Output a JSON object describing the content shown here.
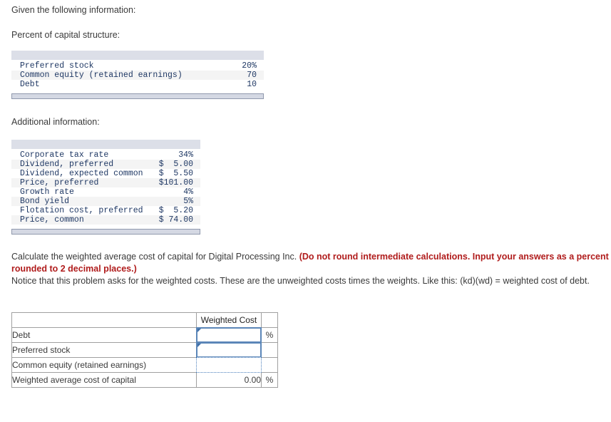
{
  "intro": {
    "given_label": "Given the following information:",
    "percent_label": "Percent of capital structure:",
    "additional_label": "Additional information:"
  },
  "capital_structure": {
    "rows": [
      {
        "label": "Preferred stock",
        "value": "20%"
      },
      {
        "label": "Common equity (retained earnings)",
        "value": "70"
      },
      {
        "label": "Debt",
        "value": "10"
      }
    ]
  },
  "additional_information": {
    "rows": [
      {
        "label": "Corporate tax rate",
        "value": "34%"
      },
      {
        "label": "Dividend, preferred",
        "value": "$  5.00"
      },
      {
        "label": "Dividend, expected common",
        "value": "$  5.50"
      },
      {
        "label": "Price, preferred",
        "value": "$101.00"
      },
      {
        "label": "Growth rate",
        "value": "4%"
      },
      {
        "label": "Bond yield",
        "value": "5%"
      },
      {
        "label": "Flotation cost, preferred",
        "value": "$  5.20"
      },
      {
        "label": "Price, common",
        "value": "$ 74.00"
      }
    ]
  },
  "question": {
    "lead": "Calculate the weighted average cost of capital for Digital Processing Inc. ",
    "emphasis": "(Do not round intermediate calculations. Input your answers as a percent rounded to 2 decimal places.)",
    "note": "Notice that this problem asks for the weighted costs. These are the unweighted costs times the weights. Like this: (kd)(wd) = weighted cost of debt."
  },
  "answer_table": {
    "header": {
      "blank": "",
      "weighted_cost": "Weighted Cost",
      "pct": ""
    },
    "rows": [
      {
        "label": "Debt",
        "value": "",
        "pct": "%"
      },
      {
        "label": "Preferred stock",
        "value": "",
        "pct": ""
      },
      {
        "label": "Common equity (retained earnings)",
        "value": "",
        "pct": ""
      },
      {
        "label": "Weighted average cost of capital",
        "value": "0.00",
        "pct": "%"
      }
    ]
  },
  "colors": {
    "table_header_bar": "#dcdfe8",
    "answer_header": "#d5dae5",
    "input_border": "#5b86b8",
    "emphasis_text": "#b01c1c",
    "data_text": "#1f3864"
  }
}
